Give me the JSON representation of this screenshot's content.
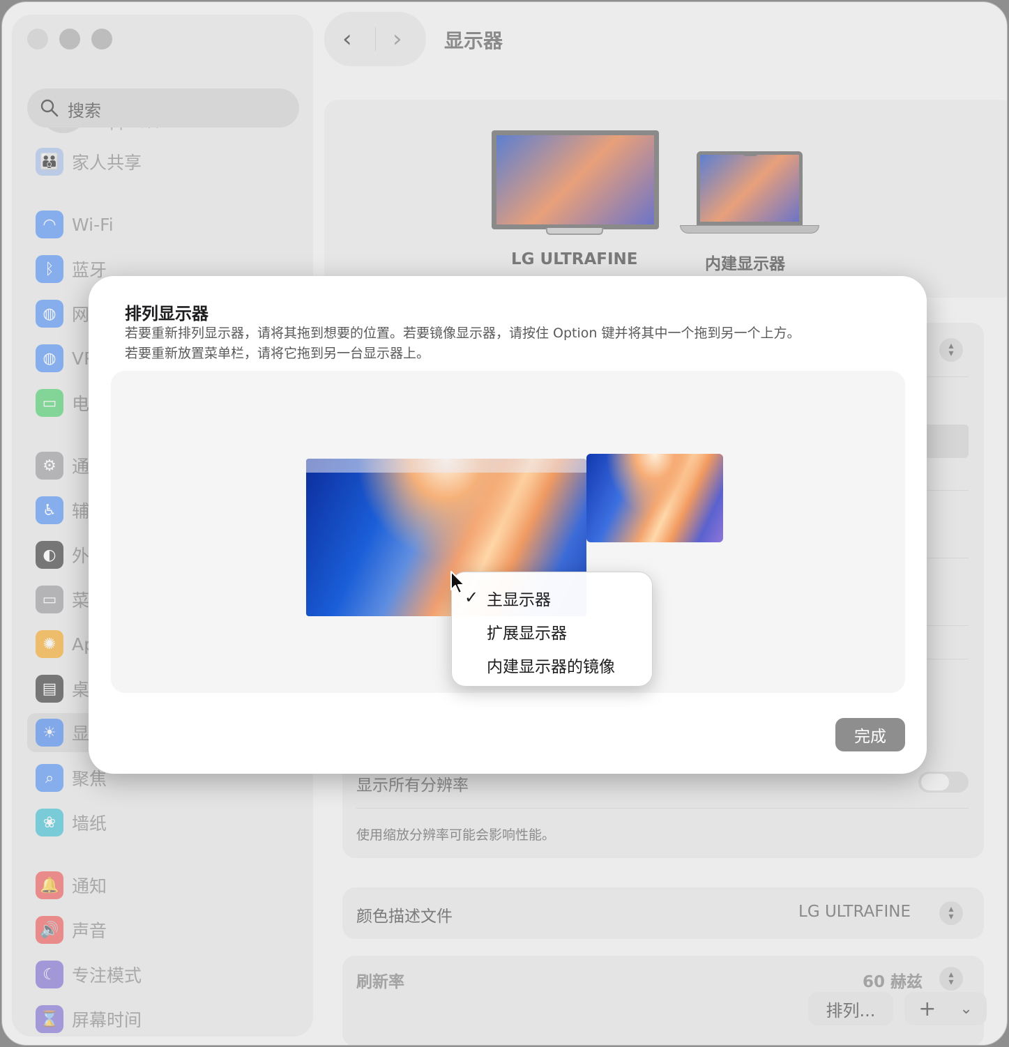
{
  "window": {
    "title": "显示器"
  },
  "sidebar": {
    "search_placeholder": "搜索",
    "account_label": "Apple账户",
    "family_label": "家人共享",
    "items": [
      {
        "label": "Wi-Fi",
        "icon": "wifi-icon",
        "color": "#3b82f6"
      },
      {
        "label": "蓝牙",
        "icon": "bluetooth-icon",
        "color": "#3b82f6"
      },
      {
        "label": "网",
        "icon": "globe-icon",
        "color": "#3b82f6"
      },
      {
        "label": "VP",
        "icon": "vpn-icon",
        "color": "#3b82f6"
      },
      {
        "label": "电",
        "icon": "battery-icon",
        "color": "#34c759"
      },
      {
        "label": "通",
        "icon": "general-gear-icon",
        "color": "#8e8e93"
      },
      {
        "label": "辅",
        "icon": "accessibility-icon",
        "color": "#3b82f6"
      },
      {
        "label": "外",
        "icon": "appearance-icon",
        "color": "#1d1d1f"
      },
      {
        "label": "菜",
        "icon": "menubar-icon",
        "color": "#8e8e93"
      },
      {
        "label": "Ap",
        "icon": "apple-intelligence-icon",
        "color": "#f59e0b"
      },
      {
        "label": "桌",
        "icon": "desktop-dock-icon",
        "color": "#1d1d1f"
      },
      {
        "label": "显",
        "icon": "display-sun-icon",
        "color": "#3b82f6"
      },
      {
        "label": "聚焦",
        "icon": "spotlight-icon",
        "color": "#3b82f6"
      },
      {
        "label": "墙纸",
        "icon": "wallpaper-icon",
        "color": "#22b8cf"
      },
      {
        "label": "通知",
        "icon": "notification-bell-icon",
        "color": "#ef4444"
      },
      {
        "label": "声音",
        "icon": "sound-icon",
        "color": "#ef4444"
      },
      {
        "label": "专注模式",
        "icon": "focus-moon-icon",
        "color": "#6d5bd0"
      },
      {
        "label": "屏幕时间",
        "icon": "screen-time-icon",
        "color": "#6d5bd0"
      }
    ]
  },
  "main": {
    "displays": [
      {
        "label": "LG ULTRAFINE"
      },
      {
        "label": "内建显示器"
      }
    ],
    "show_all_resolutions": "显示所有分辨率",
    "resolution_note": "使用缩放分辨率可能会影响性能。",
    "color_profile_label": "颜色描述文件",
    "color_profile_value": "LG ULTRAFINE",
    "refresh_label": "刷新率",
    "refresh_value": "60 赫兹",
    "arrange_button": "排列...",
    "add_button": "+",
    "chevron_button": "⌄"
  },
  "dialog": {
    "title": "排列显示器",
    "desc_line1": "若要重新排列显示器，请将其拖到想要的位置。若要镜像显示器，请按住 Option 键并将其中一个拖到另一个上方。",
    "desc_line2": "若要重新放置菜单栏，请将它拖到另一台显示器上。",
    "done_button": "完成",
    "context_menu": {
      "items": [
        {
          "label": "主显示器",
          "checked": true
        },
        {
          "label": "扩展显示器",
          "checked": false
        },
        {
          "label": "内建显示器的镜像",
          "checked": false
        }
      ],
      "check_glyph": "✓"
    }
  }
}
